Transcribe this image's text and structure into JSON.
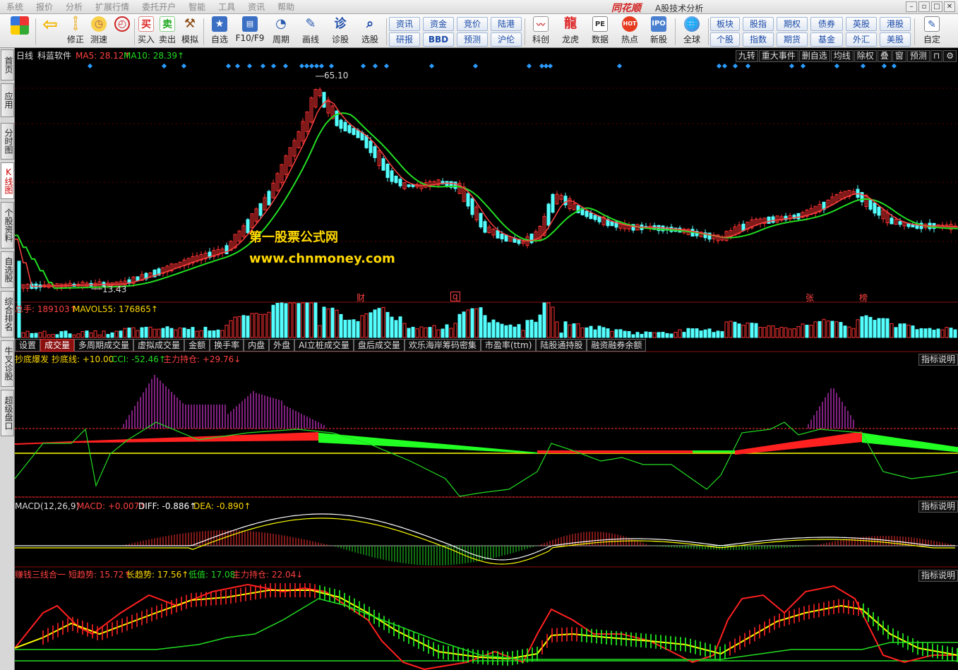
{
  "menu": {
    "items": [
      "系统",
      "报价",
      "分析",
      "扩展行情",
      "委托开户",
      "智能",
      "工具",
      "资讯",
      "帮助"
    ],
    "brand": "同花顺",
    "window_title": "A股技术分析"
  },
  "toolbar": {
    "left_buttons": [
      {
        "label": "",
        "icon": "windows-icon"
      },
      {
        "label": "",
        "icon": "back-arrow-icon"
      },
      {
        "label": "修正",
        "icon": "up-down-arrows-icon"
      },
      {
        "label": "测速",
        "icon": "stopwatch-icon"
      },
      {
        "label": "买入",
        "icon": "buy-icon",
        "glyph": "买"
      },
      {
        "label": "卖出",
        "icon": "sell-icon",
        "glyph": "卖"
      },
      {
        "label": "模拟",
        "icon": "hammer-icon"
      },
      {
        "label": "自选",
        "icon": "star-icon"
      },
      {
        "label": "F10/F9",
        "icon": "f10-icon"
      },
      {
        "label": "周期",
        "icon": "clock-icon"
      },
      {
        "label": "画线",
        "icon": "pencil-icon"
      },
      {
        "label": "诊股",
        "icon": "diagnose-icon",
        "glyph": "诊"
      },
      {
        "label": "选股",
        "icon": "magnifier-icon"
      }
    ],
    "grid_buttons": [
      [
        "资讯",
        "资金",
        "竞价",
        "陆港"
      ],
      [
        "研报",
        "BBD",
        "预测",
        "沪伦"
      ]
    ],
    "mid_buttons": [
      {
        "label": "科创",
        "icon": "kechuang-icon"
      },
      {
        "label": "龙虎",
        "icon": "dragon-icon"
      },
      {
        "label": "数据",
        "icon": "pe-icon",
        "glyph": "PE"
      },
      {
        "label": "热点",
        "icon": "hot-icon",
        "glyph": "HOT"
      },
      {
        "label": "新股",
        "icon": "ipo-icon"
      },
      {
        "label": "全球",
        "icon": "globe-icon"
      }
    ],
    "market_buttons": [
      [
        "板块",
        "股指",
        "期权",
        "债券",
        "英股",
        "港股"
      ],
      [
        "个股",
        "指数",
        "期货",
        "基金",
        "外汇",
        "美股"
      ]
    ],
    "custom_label": "自定"
  },
  "left_tabs": [
    "首页",
    "应用",
    "分时图",
    "K线图",
    "个股资料",
    "自选股",
    "综合排名",
    "牛叉诊股",
    "超级盘口"
  ],
  "chart": {
    "kline_header": {
      "period": "日线",
      "name": "科蓝软件",
      "ma5": "MA5: 28.12↑",
      "ma10": "MA10: 28.39↑"
    },
    "right_buttons": [
      "九转",
      "重大事件",
      "删自选",
      "均线",
      "除权",
      "叠",
      "窗",
      "预测"
    ],
    "high_label": "65.10",
    "low_label": "13.43",
    "watermark1": "第一股票公式网",
    "watermark2": "www.chnmoney.com",
    "markers": [
      "财",
      "q",
      "张",
      "榜"
    ],
    "volume_header": {
      "total": "总手: 189103↑",
      "mavol": "MAVOL55: 176865↑"
    },
    "sub_tabs": [
      "设置",
      "成交量",
      "多周期成交量",
      "虚拟成交量",
      "金额",
      "换手率",
      "内盘",
      "外盘",
      "AI立桩成交量",
      "盘后成交量",
      "欢乐海岸筹码密集",
      "市盈率(ttm)",
      "陆股通持股",
      "融资融券余额"
    ],
    "active_sub_tab": "成交量",
    "ind1_header": {
      "name": "抄底爆发",
      "line": "抄底线: +10.00",
      "cci": "CCI: -52.46↑",
      "zhuli": "主力持仓: +29.76↓"
    },
    "ind2_header": {
      "name": "MACD(12,26,9)",
      "macd": "MACD: +0.007↑",
      "diff": "DIFF: -0.886↑",
      "dea": "DEA: -0.890↑"
    },
    "ind3_header": {
      "name": "赚钱三线合一",
      "short": "短趋势: 15.72↑",
      "long": "长趋势: 17.56↑",
      "low": "低值: 17.08",
      "zhuli": "主力持仓: 22.04↓"
    },
    "info_btn": "指标说明",
    "colors": {
      "up": "#ff3232",
      "down": "#54ffff",
      "ma5": "#ff4040",
      "ma10": "#22dd22",
      "macd_white": "#ffffff",
      "macd_yellow": "#ffff00",
      "magenta": "#ff40ff"
    }
  }
}
